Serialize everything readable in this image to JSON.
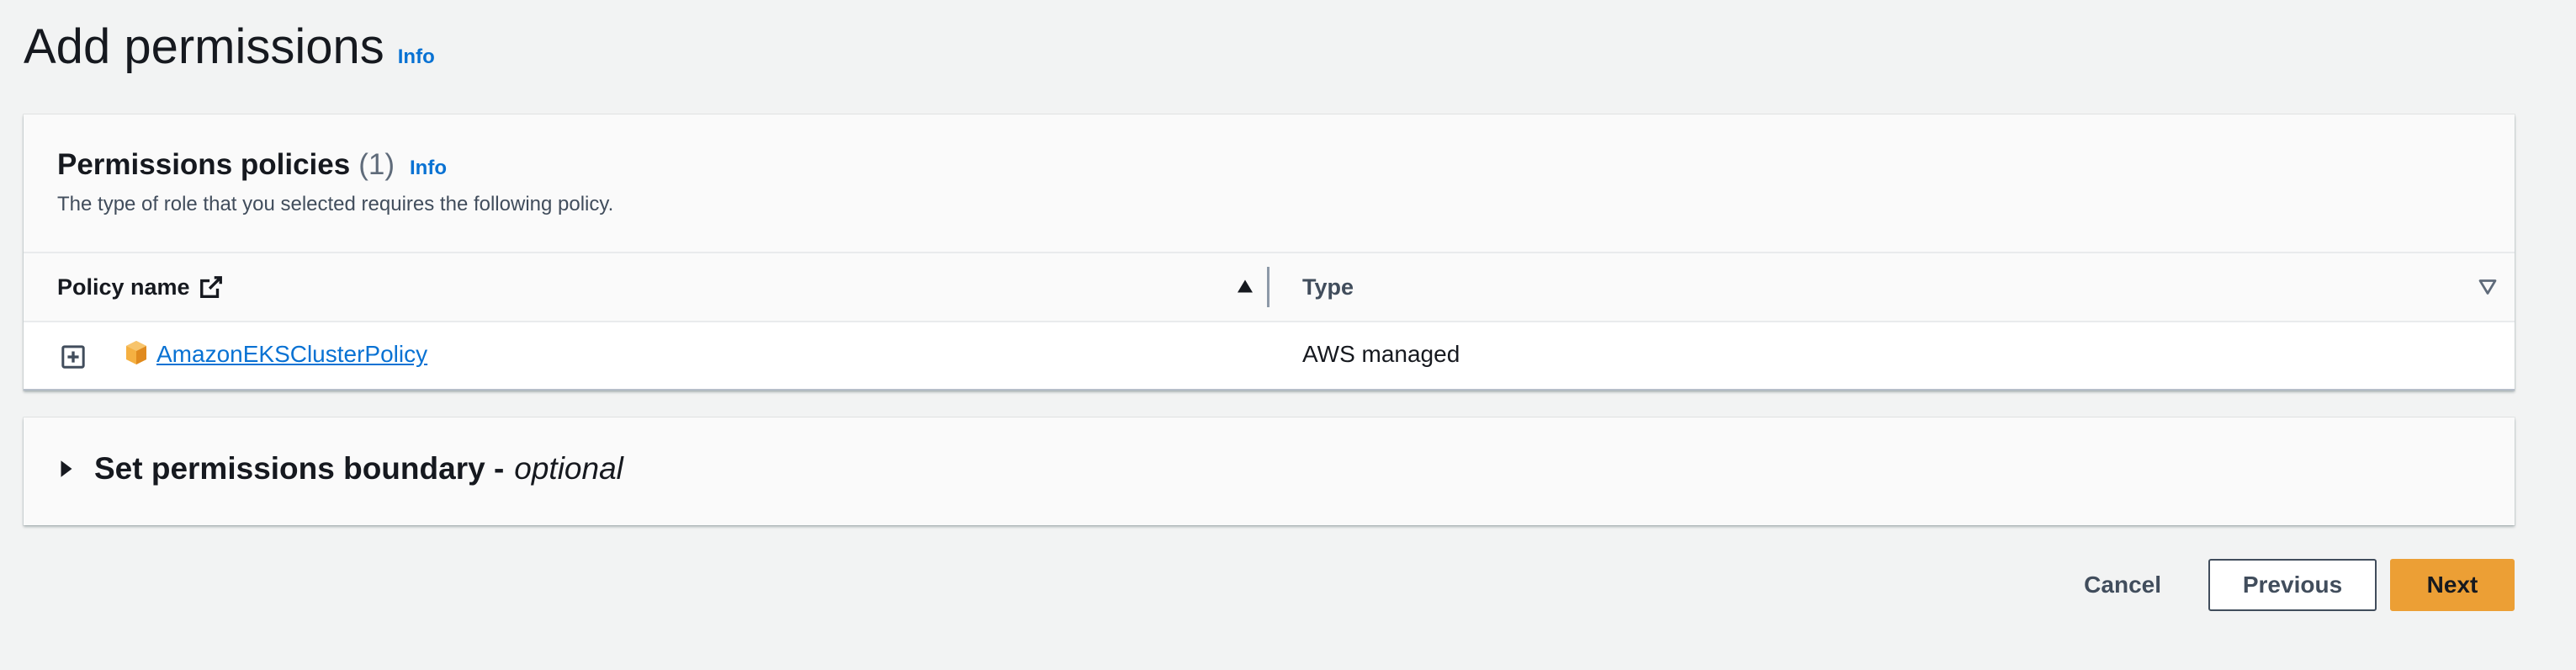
{
  "header": {
    "title": "Add permissions",
    "info_label": "Info"
  },
  "policies_panel": {
    "heading": "Permissions policies",
    "count": "(1)",
    "info_label": "Info",
    "description": "The type of role that you selected requires the following policy.",
    "columns": [
      "Policy name",
      "Type"
    ],
    "rows": [
      {
        "policy_name": "AmazonEKSClusterPolicy",
        "type": "AWS managed",
        "icon": "aws-service-cube-icon"
      }
    ],
    "sort": {
      "column": "Policy name",
      "direction": "ascending"
    }
  },
  "boundary_panel": {
    "title": "Set permissions boundary -",
    "optional": "optional",
    "expanded": false
  },
  "actions": {
    "cancel": "Cancel",
    "previous": "Previous",
    "next": "Next"
  },
  "colors": {
    "background": "#f2f3f3",
    "link": "#0972d3",
    "primary_button": "#ec9f35",
    "service_icon": "#ec9f35"
  }
}
